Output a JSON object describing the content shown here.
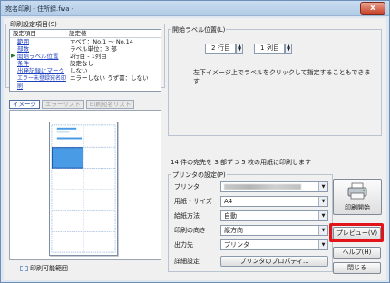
{
  "window": {
    "title": "宛名印刷 - 住所録.fwa -",
    "close_label": "x"
  },
  "settings": {
    "group_label": "印刷設定項目(S)",
    "header_item": "設定項目",
    "header_value": "設定値",
    "rows": [
      {
        "item": "範囲",
        "value": "すべて：No.1 ～ No.14"
      },
      {
        "item": "部数",
        "value": "ラベル単位：3 部"
      },
      {
        "item": "開始ラベル位置",
        "value": "2行目 - 1列目"
      },
      {
        "item": "条件",
        "value": "設定なし"
      },
      {
        "item": "出発記録にマーク",
        "value": "しない"
      },
      {
        "item": "エラー未登録宛名印刷",
        "value": "エラーしない うず書：しない"
      }
    ]
  },
  "tabs": {
    "image": "イメージ",
    "error_list": "エラーリスト",
    "print_list": "印刷宛名リスト"
  },
  "preview": {
    "printable_label": "印刷可能範囲"
  },
  "start_position": {
    "group_label": "開始ラベル位置(L)",
    "row_value": "2",
    "row_unit": "行目",
    "col_value": "1",
    "col_unit": "列目",
    "hint": "左下イメージ上でラベルをクリックして指定することもできます"
  },
  "summary": "14 件の宛先を 3 部ずつ 5 枚の用紙に印刷します",
  "printer": {
    "group_label": "プリンタの設定(P)",
    "rows": [
      {
        "label": "プリンタ",
        "value": ""
      },
      {
        "label": "用紙・サイズ",
        "value": "A4"
      },
      {
        "label": "給紙方法",
        "value": "自動"
      },
      {
        "label": "印刷の向き",
        "value": "縦方向"
      },
      {
        "label": "出力先",
        "value": "プリンタ"
      },
      {
        "label": "詳細設定",
        "button": "プリンタのプロパティ..."
      }
    ]
  },
  "buttons": {
    "print": "印刷開始",
    "preview": "プレビュー(V)",
    "help": "ヘルプ(H)",
    "close": "閉じる"
  },
  "colors": {
    "highlight": "#e3131a",
    "selected_label": "#4a9be6"
  }
}
